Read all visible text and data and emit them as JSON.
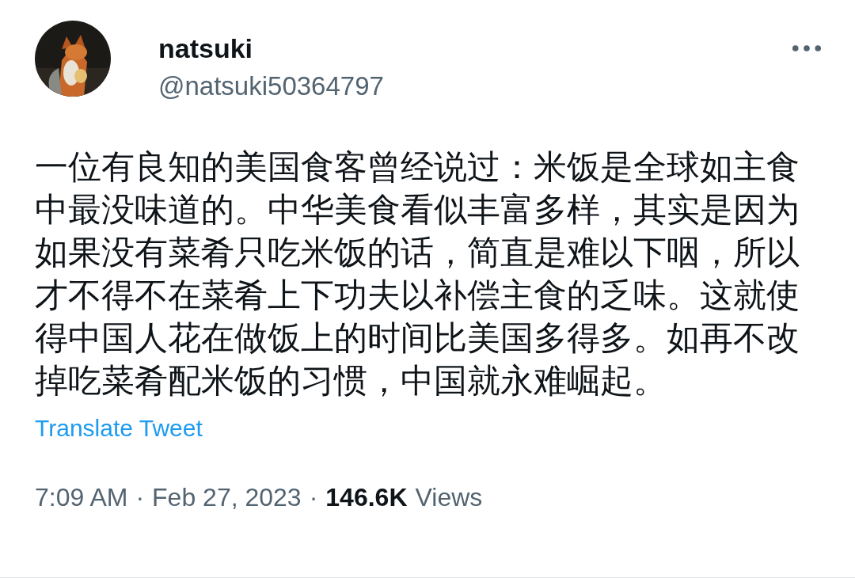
{
  "author": {
    "name": "natsuki",
    "handle": "@natsuki50364797"
  },
  "text": "一位有良知的美国食客曾经说过：米饭是全球如主食中最没味道的。中华美食看似丰富多样，其实是因为如果没有菜肴只吃米饭的话，简直是难以下咽，所以才不得不在菜肴上下功夫以补偿主食的乏味。这就使得中国人花在做饭上的时间比美国多得多。如再不改掉吃菜肴配米饭的习惯，中国就永难崛起。",
  "translate_link": "Translate Tweet",
  "meta": {
    "time": "7:09 AM",
    "separator_1": "·",
    "date": "Feb 27, 2023",
    "separator_2": "·",
    "views_count": "146.6K",
    "views_label": "Views"
  }
}
